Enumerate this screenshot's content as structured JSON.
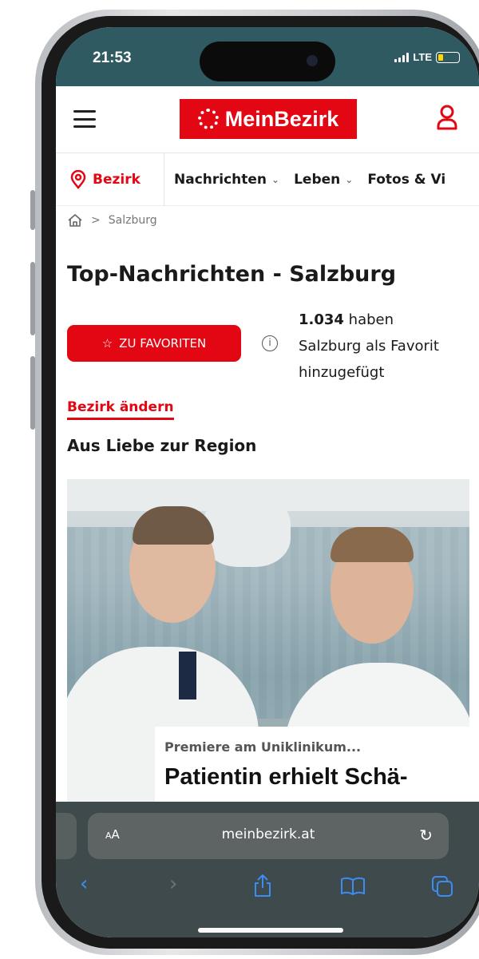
{
  "status_bar": {
    "time": "21:53",
    "network": "LTE",
    "battery_level": 0.25,
    "battery_color": "#ffd60a"
  },
  "header": {
    "menu_icon": "hamburger-icon",
    "logo_text": "MeinBezirk",
    "brand_color": "#e30613",
    "account_icon": "user-icon"
  },
  "nav": {
    "location_icon": "location-pin-icon",
    "location_label": "Bezirk",
    "items": [
      {
        "label": "Nachrichten",
        "has_dropdown": true
      },
      {
        "label": "Leben",
        "has_dropdown": true
      },
      {
        "label": "Fotos & Vi",
        "has_dropdown": false
      }
    ]
  },
  "breadcrumb": {
    "home_icon": "home-icon",
    "separator": ">",
    "current": "Salzburg"
  },
  "page": {
    "title": "Top-Nachrichten - Salzburg",
    "favorite_button": "ZU FAVORITEN",
    "favorite_count": "1.034",
    "favorite_text_1": " haben",
    "favorite_text_2": "Salzburg als Favorit",
    "favorite_text_3": "hinzugefügt",
    "change_link": "Bezirk ändern",
    "section_heading": "Aus Liebe zur Region"
  },
  "article": {
    "kicker": "Premiere am Uniklinikum...",
    "title": "Patientin erhielt Schä-"
  },
  "browser": {
    "text_size_label_small": "A",
    "text_size_label_large": "A",
    "url": "meinbezirk.at",
    "reload_icon": "reload-icon",
    "tools": [
      "back-icon",
      "forward-icon",
      "share-icon",
      "bookmarks-icon",
      "tabs-icon"
    ]
  }
}
